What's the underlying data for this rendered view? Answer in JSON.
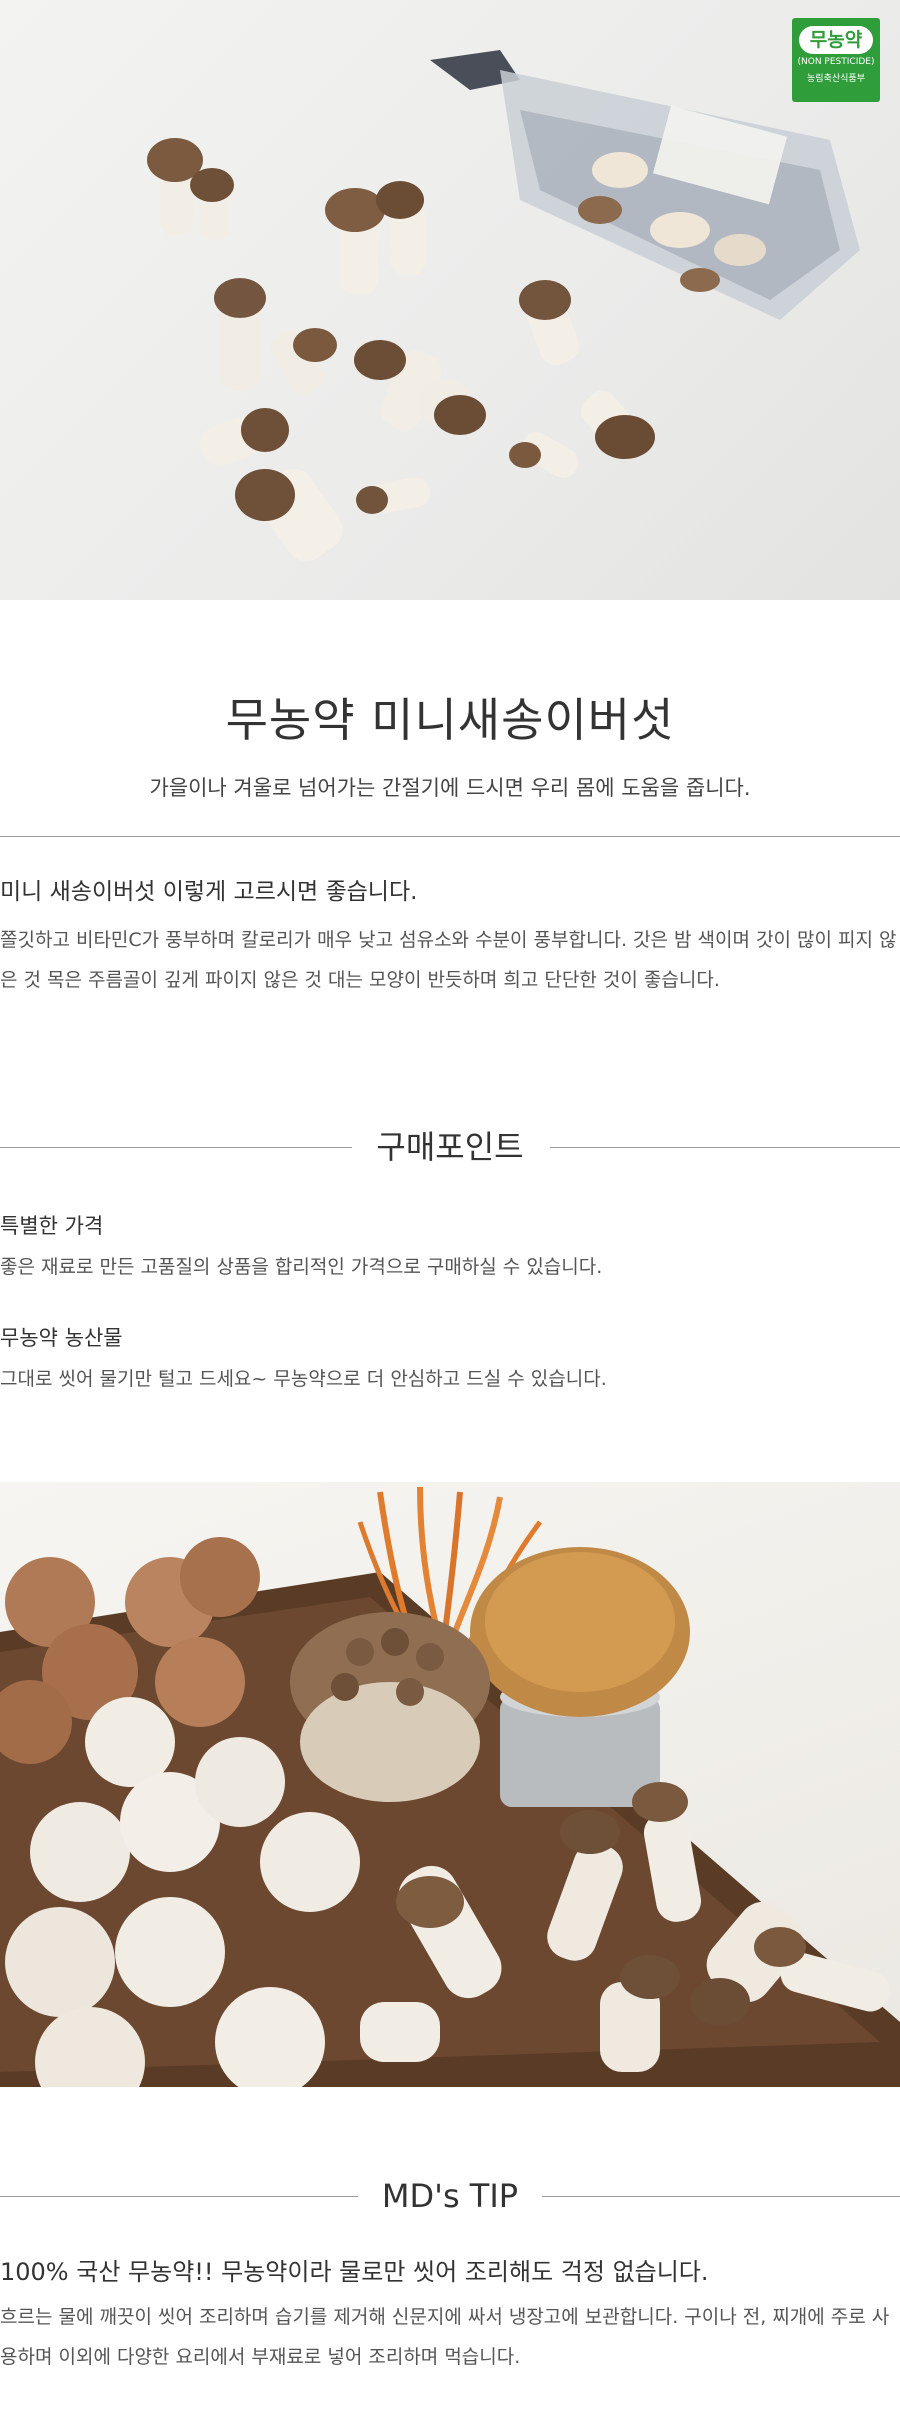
{
  "badge": {
    "title": "무농약",
    "subtitle": "(NON PESTICIDE)",
    "org": "농림축산식품부"
  },
  "product": {
    "title": "무농약 미니새송이버섯",
    "subtitle": "가을이나 겨울로 넘어가는 간절기에 드시면 우리 몸에 도움을 줍니다."
  },
  "selection": {
    "heading": "미니 새송이버섯 이렇게 고르시면 좋습니다.",
    "body": "쫄깃하고 비타민C가 풍부하며 칼로리가 매우 낮고 섬유소와 수분이 풍부합니다. 갓은 밤 색이며 갓이 많이 피지 않은 것 목은 주름골이 깊게 파이지 않은 것 대는 모양이 반듯하며 희고 단단한 것이 좋습니다."
  },
  "purchase_points": {
    "heading": "구매포인트",
    "items": [
      {
        "title": "특별한 가격",
        "desc": "좋은 재료로 만든 고품질의 상품을 합리적인 가격으로 구매하실 수 있습니다."
      },
      {
        "title": "무농약 농산물",
        "desc": "그대로 씻어 물기만 털고 드세요~ 무농약으로 더 안심하고 드실 수 있습니다."
      }
    ]
  },
  "md_tip": {
    "heading": "MD's TIP",
    "title": "100% 국산 무농약!! 무농약이라 물로만 씻어 조리해도 걱정 없습니다.",
    "body": "흐르는 물에 깨끗이 씻어 조리하며 습기를 제거해 신문지에 싸서 냉장고에 보관합니다. 구이나 전, 찌개에 주로 사용하며 이외에 다양한 요리에서 부재료로 넣어 조리하며 먹습니다."
  },
  "colors": {
    "badge_green": "#2f9d3a",
    "divider": "#9a9a9a"
  }
}
